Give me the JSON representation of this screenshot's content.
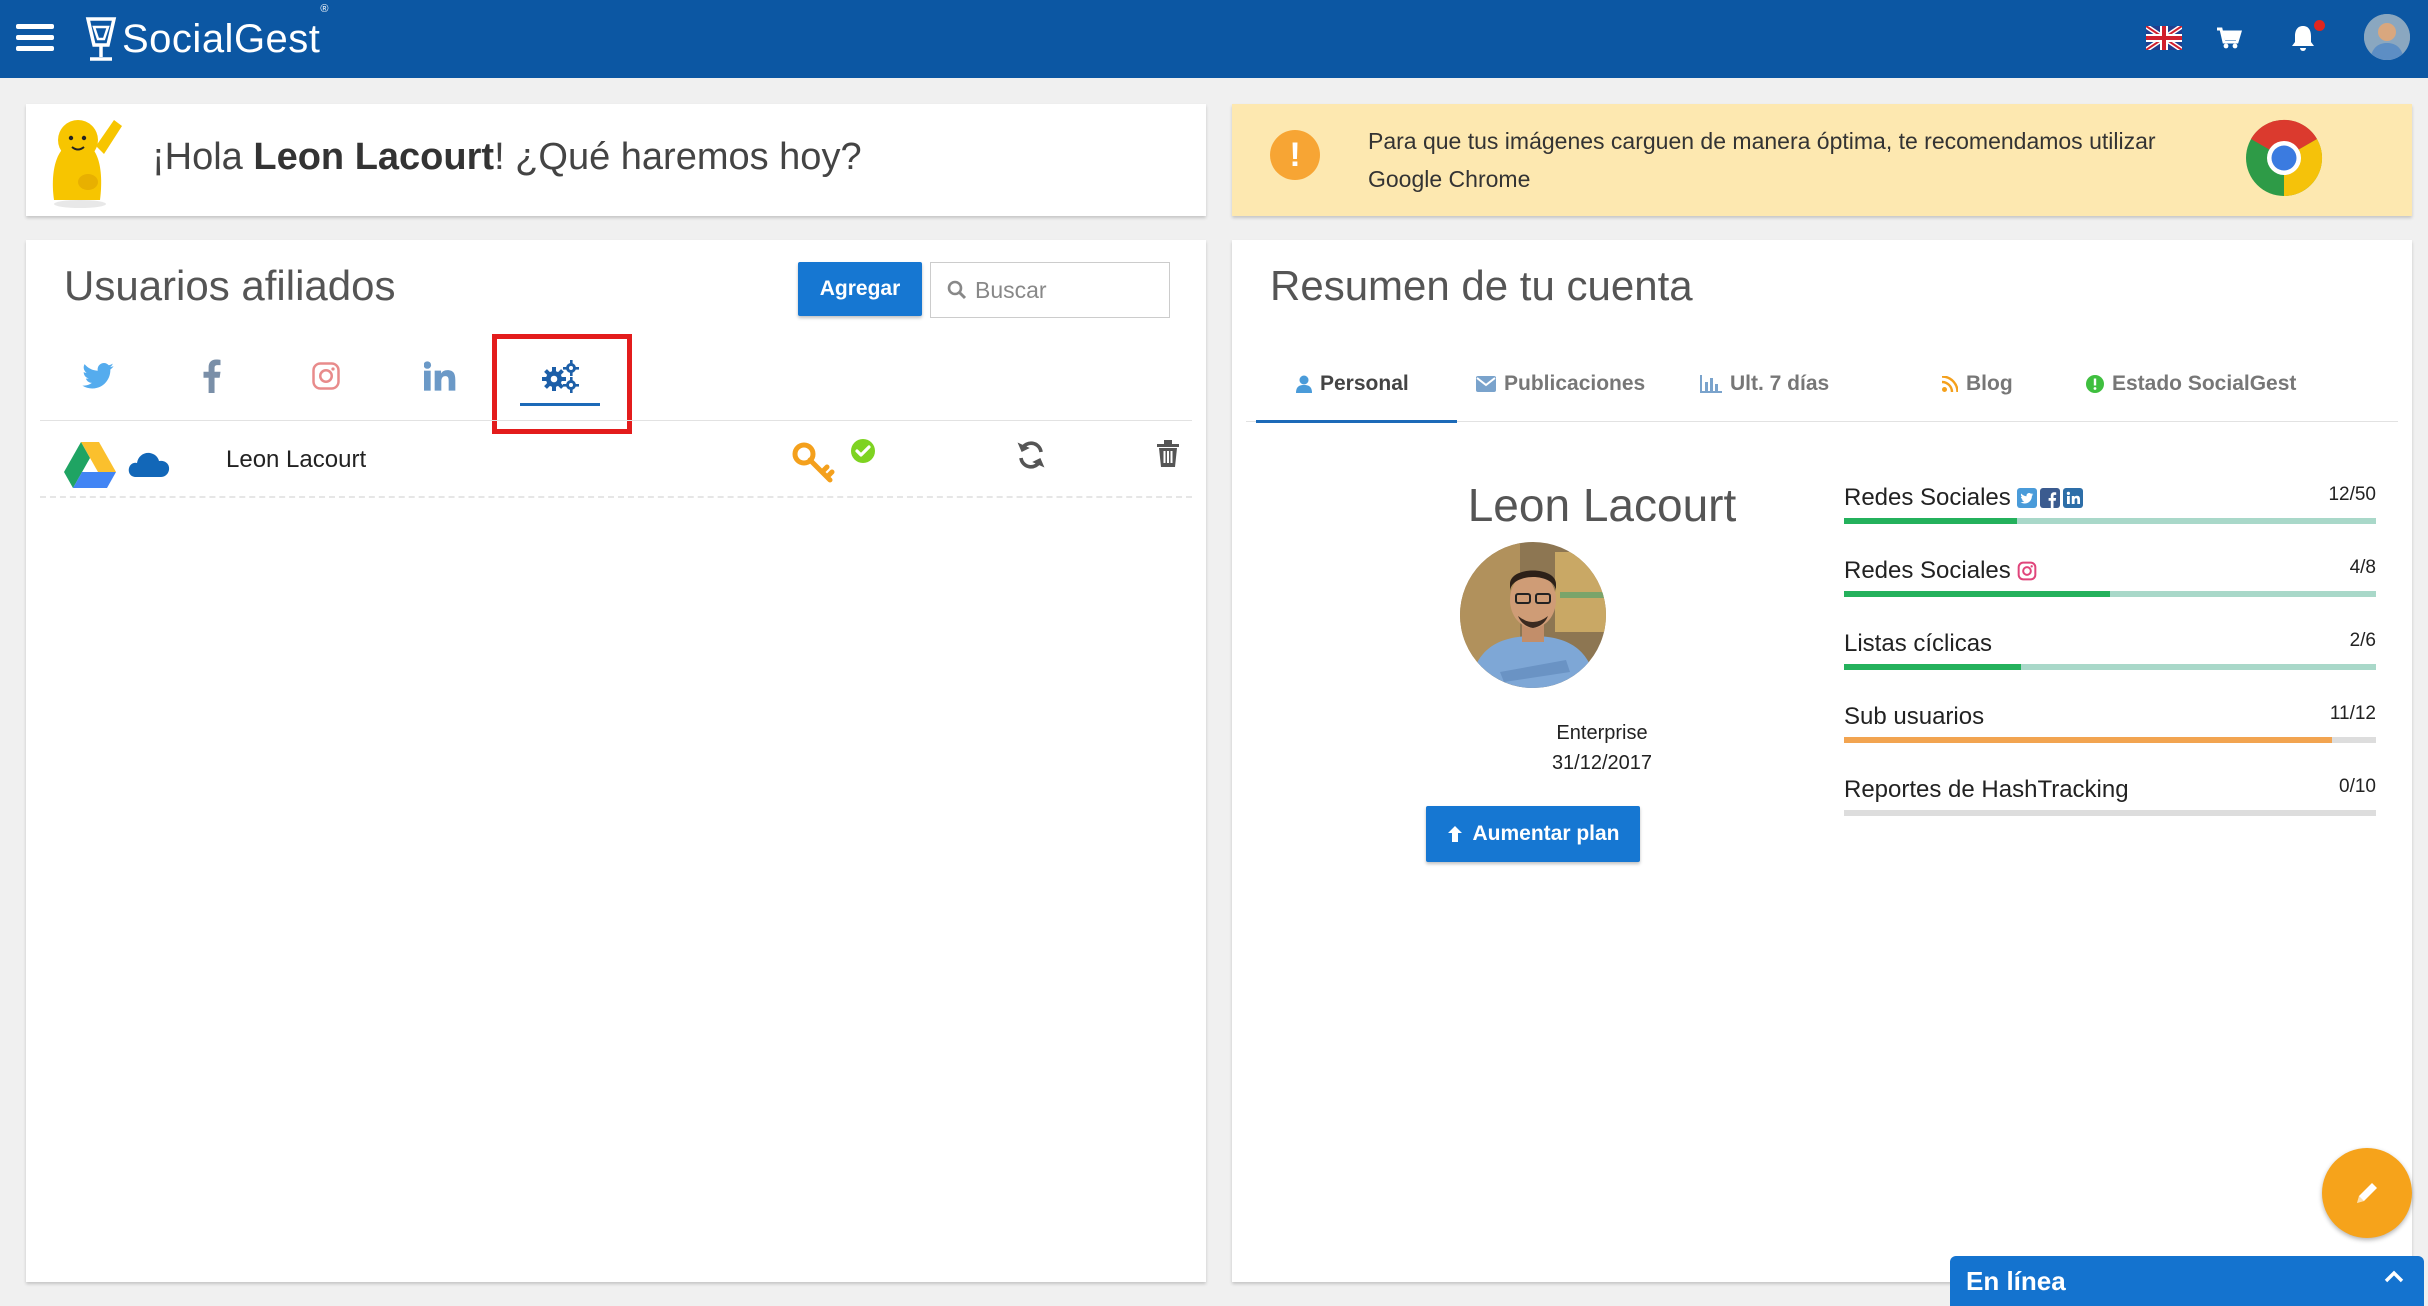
{
  "app": {
    "name": "SocialGest",
    "trademark": "®"
  },
  "topbar": {
    "icons": [
      "menu-icon",
      "uk-flag-icon",
      "cart-icon",
      "bell-icon",
      "user-avatar"
    ],
    "colors": {
      "bar": "#0c57a3",
      "notification_dot": "#e0261e"
    }
  },
  "greeting": {
    "prefix": "¡Hola ",
    "user": "Leon Lacourt",
    "suffix": "! ¿Qué haremos hoy?"
  },
  "alert": {
    "text": "Para que tus imágenes carguen de manera óptima, te recomendamos utilizar Google Chrome",
    "icon": "exclamation-icon",
    "background": "#fde8b0"
  },
  "affiliates": {
    "title": "Usuarios afiliados",
    "add_label": "Agregar",
    "search_placeholder": "Buscar",
    "tabs": [
      {
        "icon": "twitter-icon",
        "active": false
      },
      {
        "icon": "facebook-icon",
        "active": false
      },
      {
        "icon": "instagram-icon",
        "active": false
      },
      {
        "icon": "linkedin-icon",
        "active": false
      },
      {
        "icon": "cogs-icon",
        "active": true
      }
    ],
    "rows": [
      {
        "icons": [
          "google-drive-icon",
          "onedrive-icon"
        ],
        "name": "Leon Lacourt",
        "status_icons": [
          "key-icon",
          "check-circle-icon"
        ],
        "actions": [
          "refresh-icon",
          "trash-icon"
        ]
      }
    ]
  },
  "summary": {
    "title": "Resumen de tu cuenta",
    "tabs": [
      {
        "label": "Personal",
        "icon": "user-icon",
        "active": true
      },
      {
        "label": "Publicaciones",
        "icon": "envelope-icon",
        "active": false
      },
      {
        "label": "Ult. 7 días",
        "icon": "bar-chart-icon",
        "active": false
      },
      {
        "label": "Blog",
        "icon": "rss-icon",
        "active": false
      },
      {
        "label": "Estado SocialGest",
        "icon": "status-dot-icon",
        "active": false
      }
    ],
    "profile": {
      "name": "Leon Lacourt",
      "plan": "Enterprise",
      "expiry": "31/12/2017",
      "upgrade_label": "Aumentar plan"
    },
    "usage": [
      {
        "label": "Redes Sociales",
        "icons": [
          "twitter-icon",
          "facebook-icon",
          "linkedin-icon"
        ],
        "count": "12/50",
        "used": 12,
        "limit": 50,
        "bar": "green"
      },
      {
        "label": "Redes Sociales",
        "icons": [
          "instagram-icon"
        ],
        "count": "4/8",
        "used": 4,
        "limit": 8,
        "bar": "green"
      },
      {
        "label": "Listas cíclicas",
        "icons": [],
        "count": "2/6",
        "used": 2,
        "limit": 6,
        "bar": "green"
      },
      {
        "label": "Sub usuarios",
        "icons": [],
        "count": "11/12",
        "used": 11,
        "limit": 12,
        "bar": "orange"
      },
      {
        "label": "Reportes de HashTracking",
        "icons": [],
        "count": "0/10",
        "used": 0,
        "limit": 10,
        "bar": "gray"
      }
    ]
  },
  "chat": {
    "label": "En línea"
  },
  "fab": {
    "icon": "pencil-icon",
    "color": "#f6a31b"
  }
}
